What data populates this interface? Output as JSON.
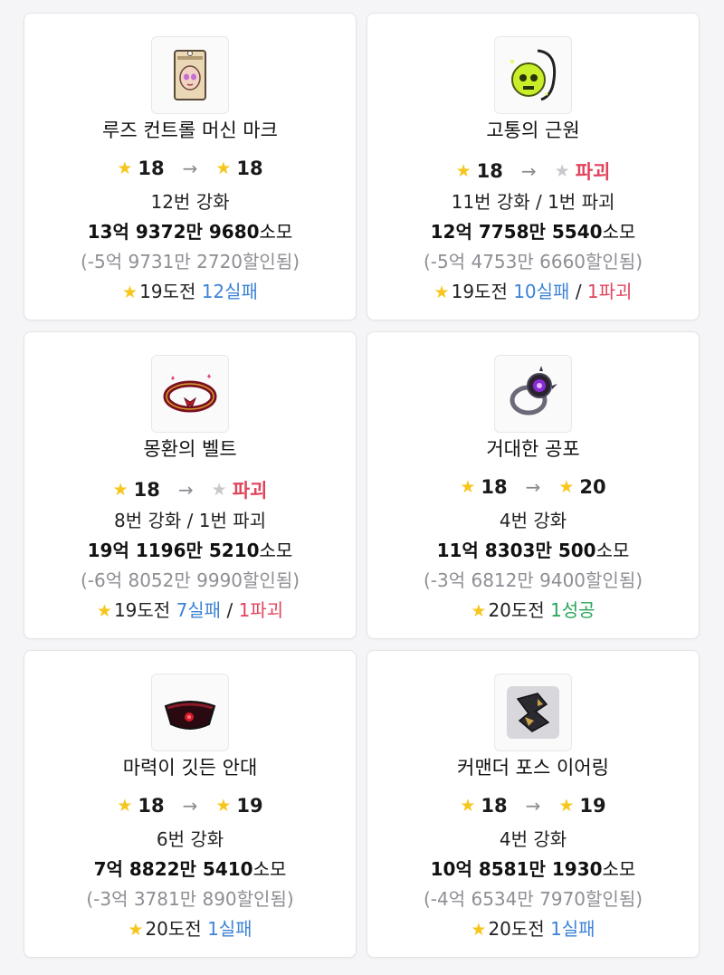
{
  "items": [
    {
      "name": "루즈 컨트롤 머신 마크",
      "icon": "machine-mark-icon",
      "from_star": "18",
      "to_star": "18",
      "to_destroyed": false,
      "attempts": "12번 강화",
      "cost": "13억 9372만 9680",
      "cost_unit": "소모",
      "discount": "(-5억 9731만 2720할인됨)",
      "challenge": "19도전",
      "result1": "12실패",
      "result1_type": "fail",
      "result2": ""
    },
    {
      "name": "고통의 근원",
      "icon": "skull-pendant-icon",
      "from_star": "18",
      "to_star": "파괴",
      "to_destroyed": true,
      "attempts": "11번 강화 / 1번 파괴",
      "cost": "12억 7758만 5540",
      "cost_unit": "소모",
      "discount": "(-5억 4753만 6660할인됨)",
      "challenge": "19도전",
      "result1": "10실패",
      "result1_type": "fail",
      "result2": "1파괴"
    },
    {
      "name": "몽환의 벨트",
      "icon": "dreamy-belt-icon",
      "from_star": "18",
      "to_star": "파괴",
      "to_destroyed": true,
      "attempts": "8번 강화 / 1번 파괴",
      "cost": "19억 1196만 5210",
      "cost_unit": "소모",
      "discount": "(-6억 8052만 9990할인됨)",
      "challenge": "19도전",
      "result1": "7실패",
      "result1_type": "fail",
      "result2": "1파괴"
    },
    {
      "name": "거대한 공포",
      "icon": "giant-fear-ring-icon",
      "from_star": "18",
      "to_star": "20",
      "to_destroyed": false,
      "attempts": "4번 강화",
      "cost": "11억 8303만 500",
      "cost_unit": "소모",
      "discount": "(-3억 6812만 9400할인됨)",
      "challenge": "20도전",
      "result1": "1성공",
      "result1_type": "ok",
      "result2": ""
    },
    {
      "name": "마력이 깃든 안대",
      "icon": "eyepatch-icon",
      "from_star": "18",
      "to_star": "19",
      "to_destroyed": false,
      "attempts": "6번 강화",
      "cost": "7억 8822만 5410",
      "cost_unit": "소모",
      "discount": "(-3억 3781만 890할인됨)",
      "challenge": "20도전",
      "result1": "1실패",
      "result1_type": "fail",
      "result2": ""
    },
    {
      "name": "커맨더 포스 이어링",
      "icon": "commander-earring-icon",
      "from_star": "18",
      "to_star": "19",
      "to_destroyed": false,
      "attempts": "4번 강화",
      "cost": "10억 8581만 1930",
      "cost_unit": "소모",
      "discount": "(-4억 6534만 7970할인됨)",
      "challenge": "20도전",
      "result1": "1실패",
      "result1_type": "fail",
      "result2": ""
    }
  ],
  "symbols": {
    "star": "★",
    "arrow": "→",
    "separator": "/"
  },
  "colors": {
    "star": "#f6c61c",
    "star_destroyed": "#c8c8cc",
    "fail": "#3d83d6",
    "destroy": "#e0445c",
    "success": "#2aa55a",
    "discount": "#8e8e94"
  }
}
